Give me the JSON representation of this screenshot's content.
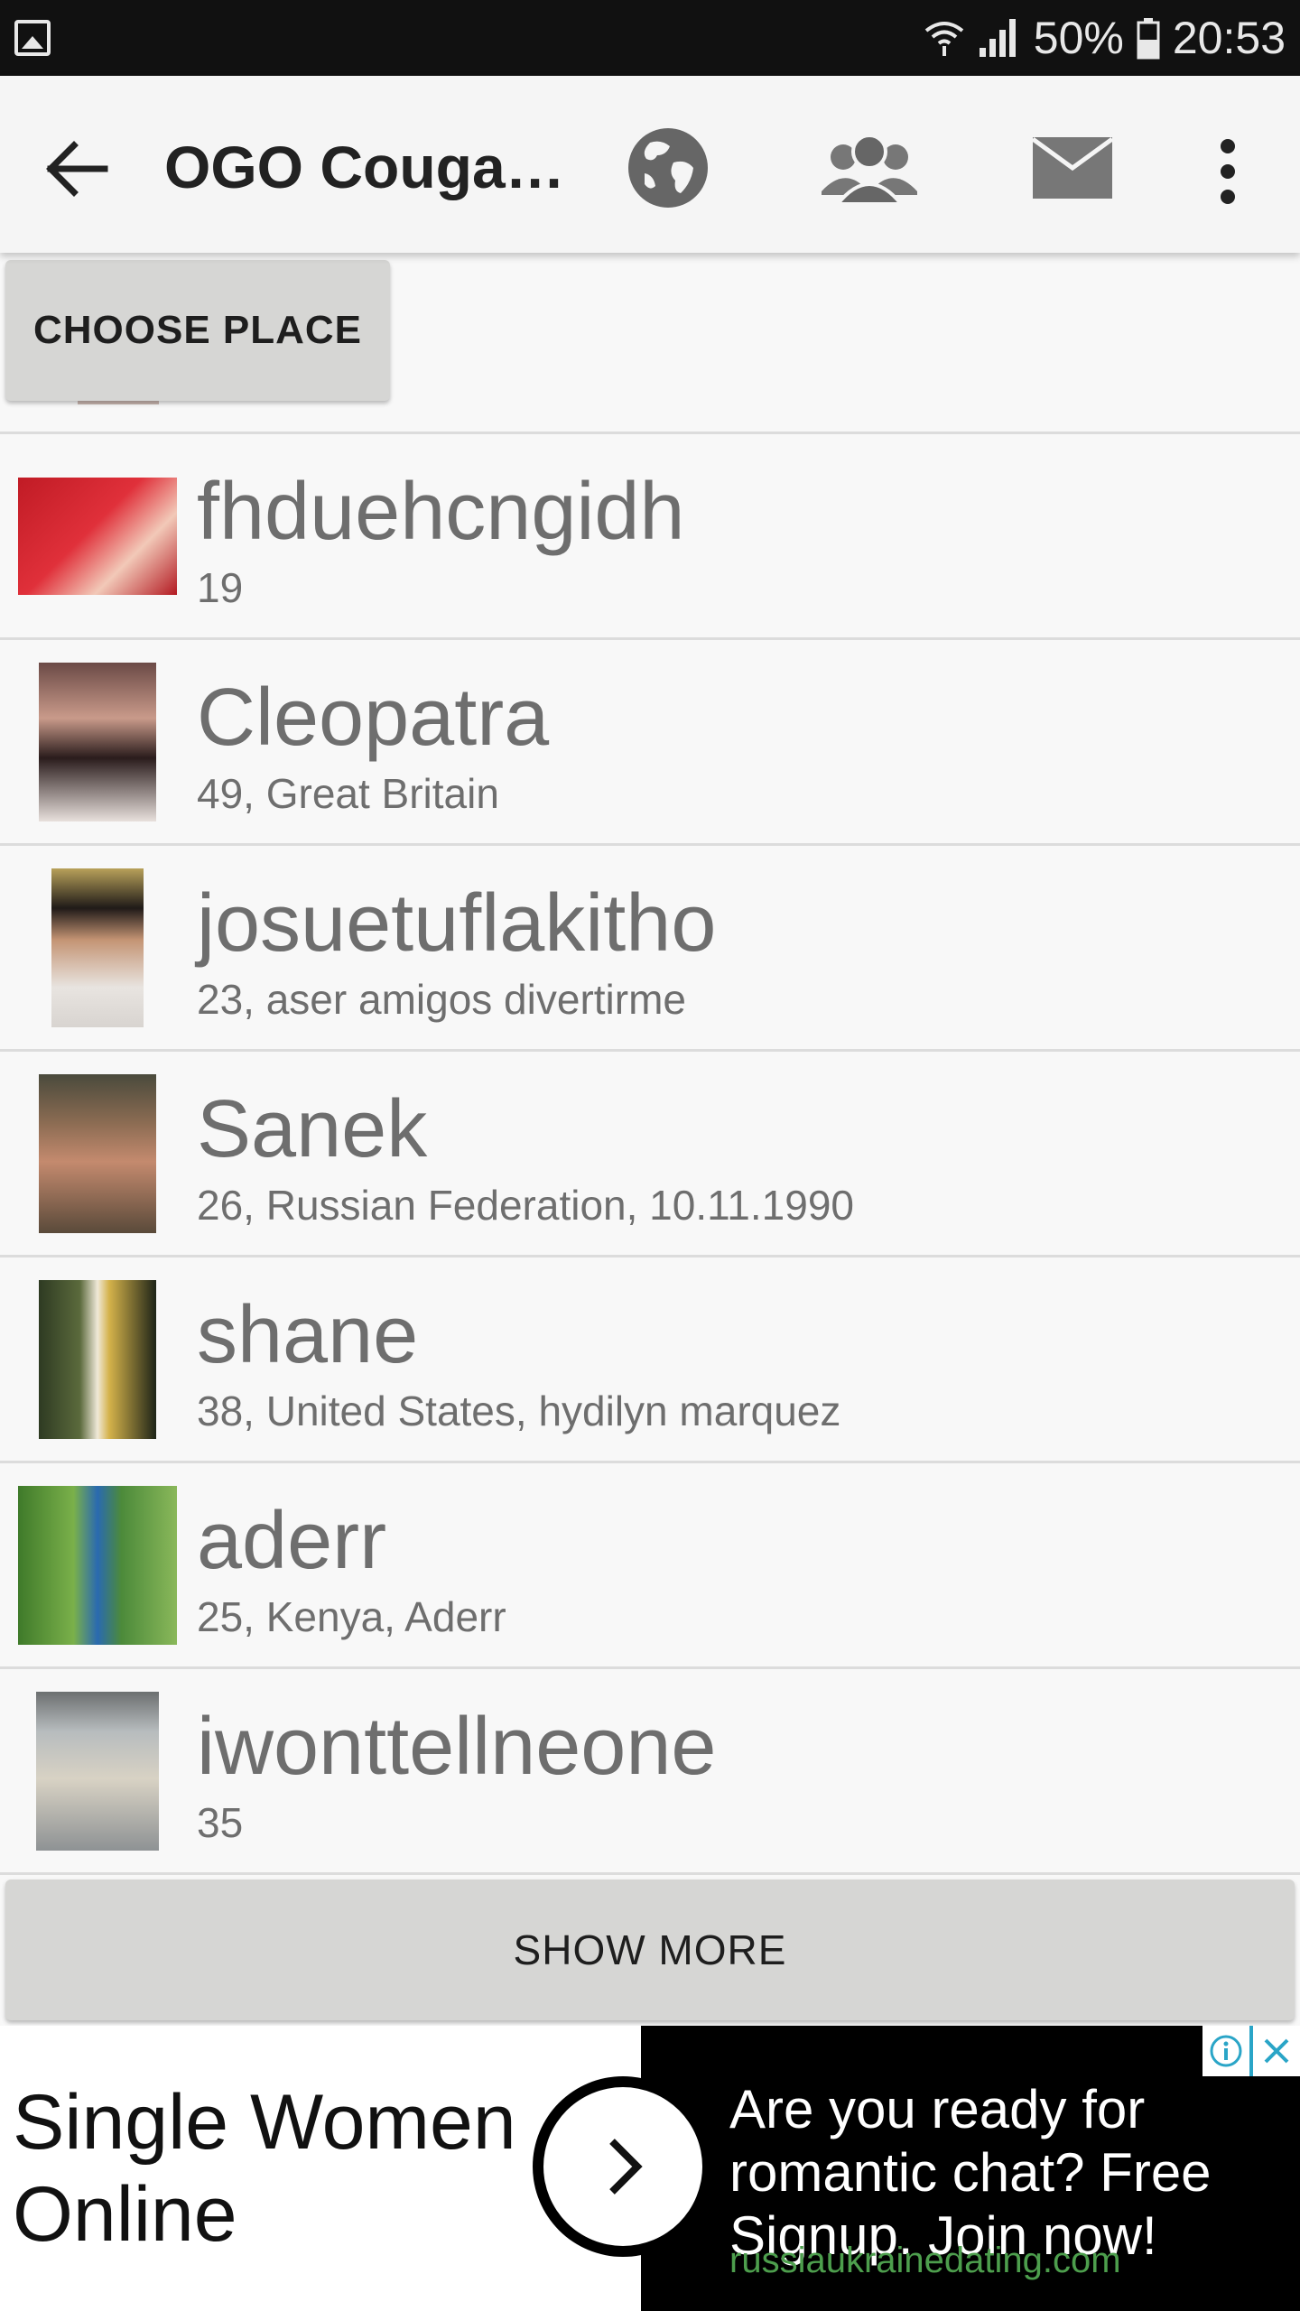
{
  "status_bar": {
    "battery": "50%",
    "time": "20:53",
    "icons": [
      "gallery-icon",
      "wifi-icon",
      "signal-icon",
      "battery-icon"
    ]
  },
  "app_bar": {
    "title": "OGO Couga…",
    "icons": [
      "back-arrow-icon",
      "globe-icon",
      "people-icon",
      "mail-icon",
      "more-vert-icon"
    ]
  },
  "choose_place": {
    "label": "CHOOSE PLACE"
  },
  "users": [
    {
      "name": "fhduehcngidh",
      "details": "19",
      "thumb_color": "#d92a35"
    },
    {
      "name": "Cleopatra",
      "details": "49, Great Britain",
      "thumb_color": "#5a3a34"
    },
    {
      "name": "josuetuflakitho",
      "details": "23, aser amigos divertirme",
      "thumb_color": "#c89a7a"
    },
    {
      "name": "Sanek",
      "details": "26, Russian Federation, 10.11.1990",
      "thumb_color": "#8a6a4e"
    },
    {
      "name": "shane",
      "details": "38, United States, hydilyn marquez",
      "thumb_color": "#4f5a3a"
    },
    {
      "name": "aderr",
      "details": "25, Kenya, Aderr",
      "thumb_color": "#4c8a3a"
    },
    {
      "name": "iwonttellneone",
      "details": "35",
      "thumb_color": "#9aa0a3"
    }
  ],
  "show_more": {
    "label": "SHOW MORE"
  },
  "ad": {
    "headline": "Single Women Online",
    "body": "Are you ready for romantic chat? Free Signup. Join now!",
    "domain": "russiaukrainedating.com",
    "icons": [
      "arrow-right-icon",
      "info-icon",
      "close-icon"
    ]
  }
}
